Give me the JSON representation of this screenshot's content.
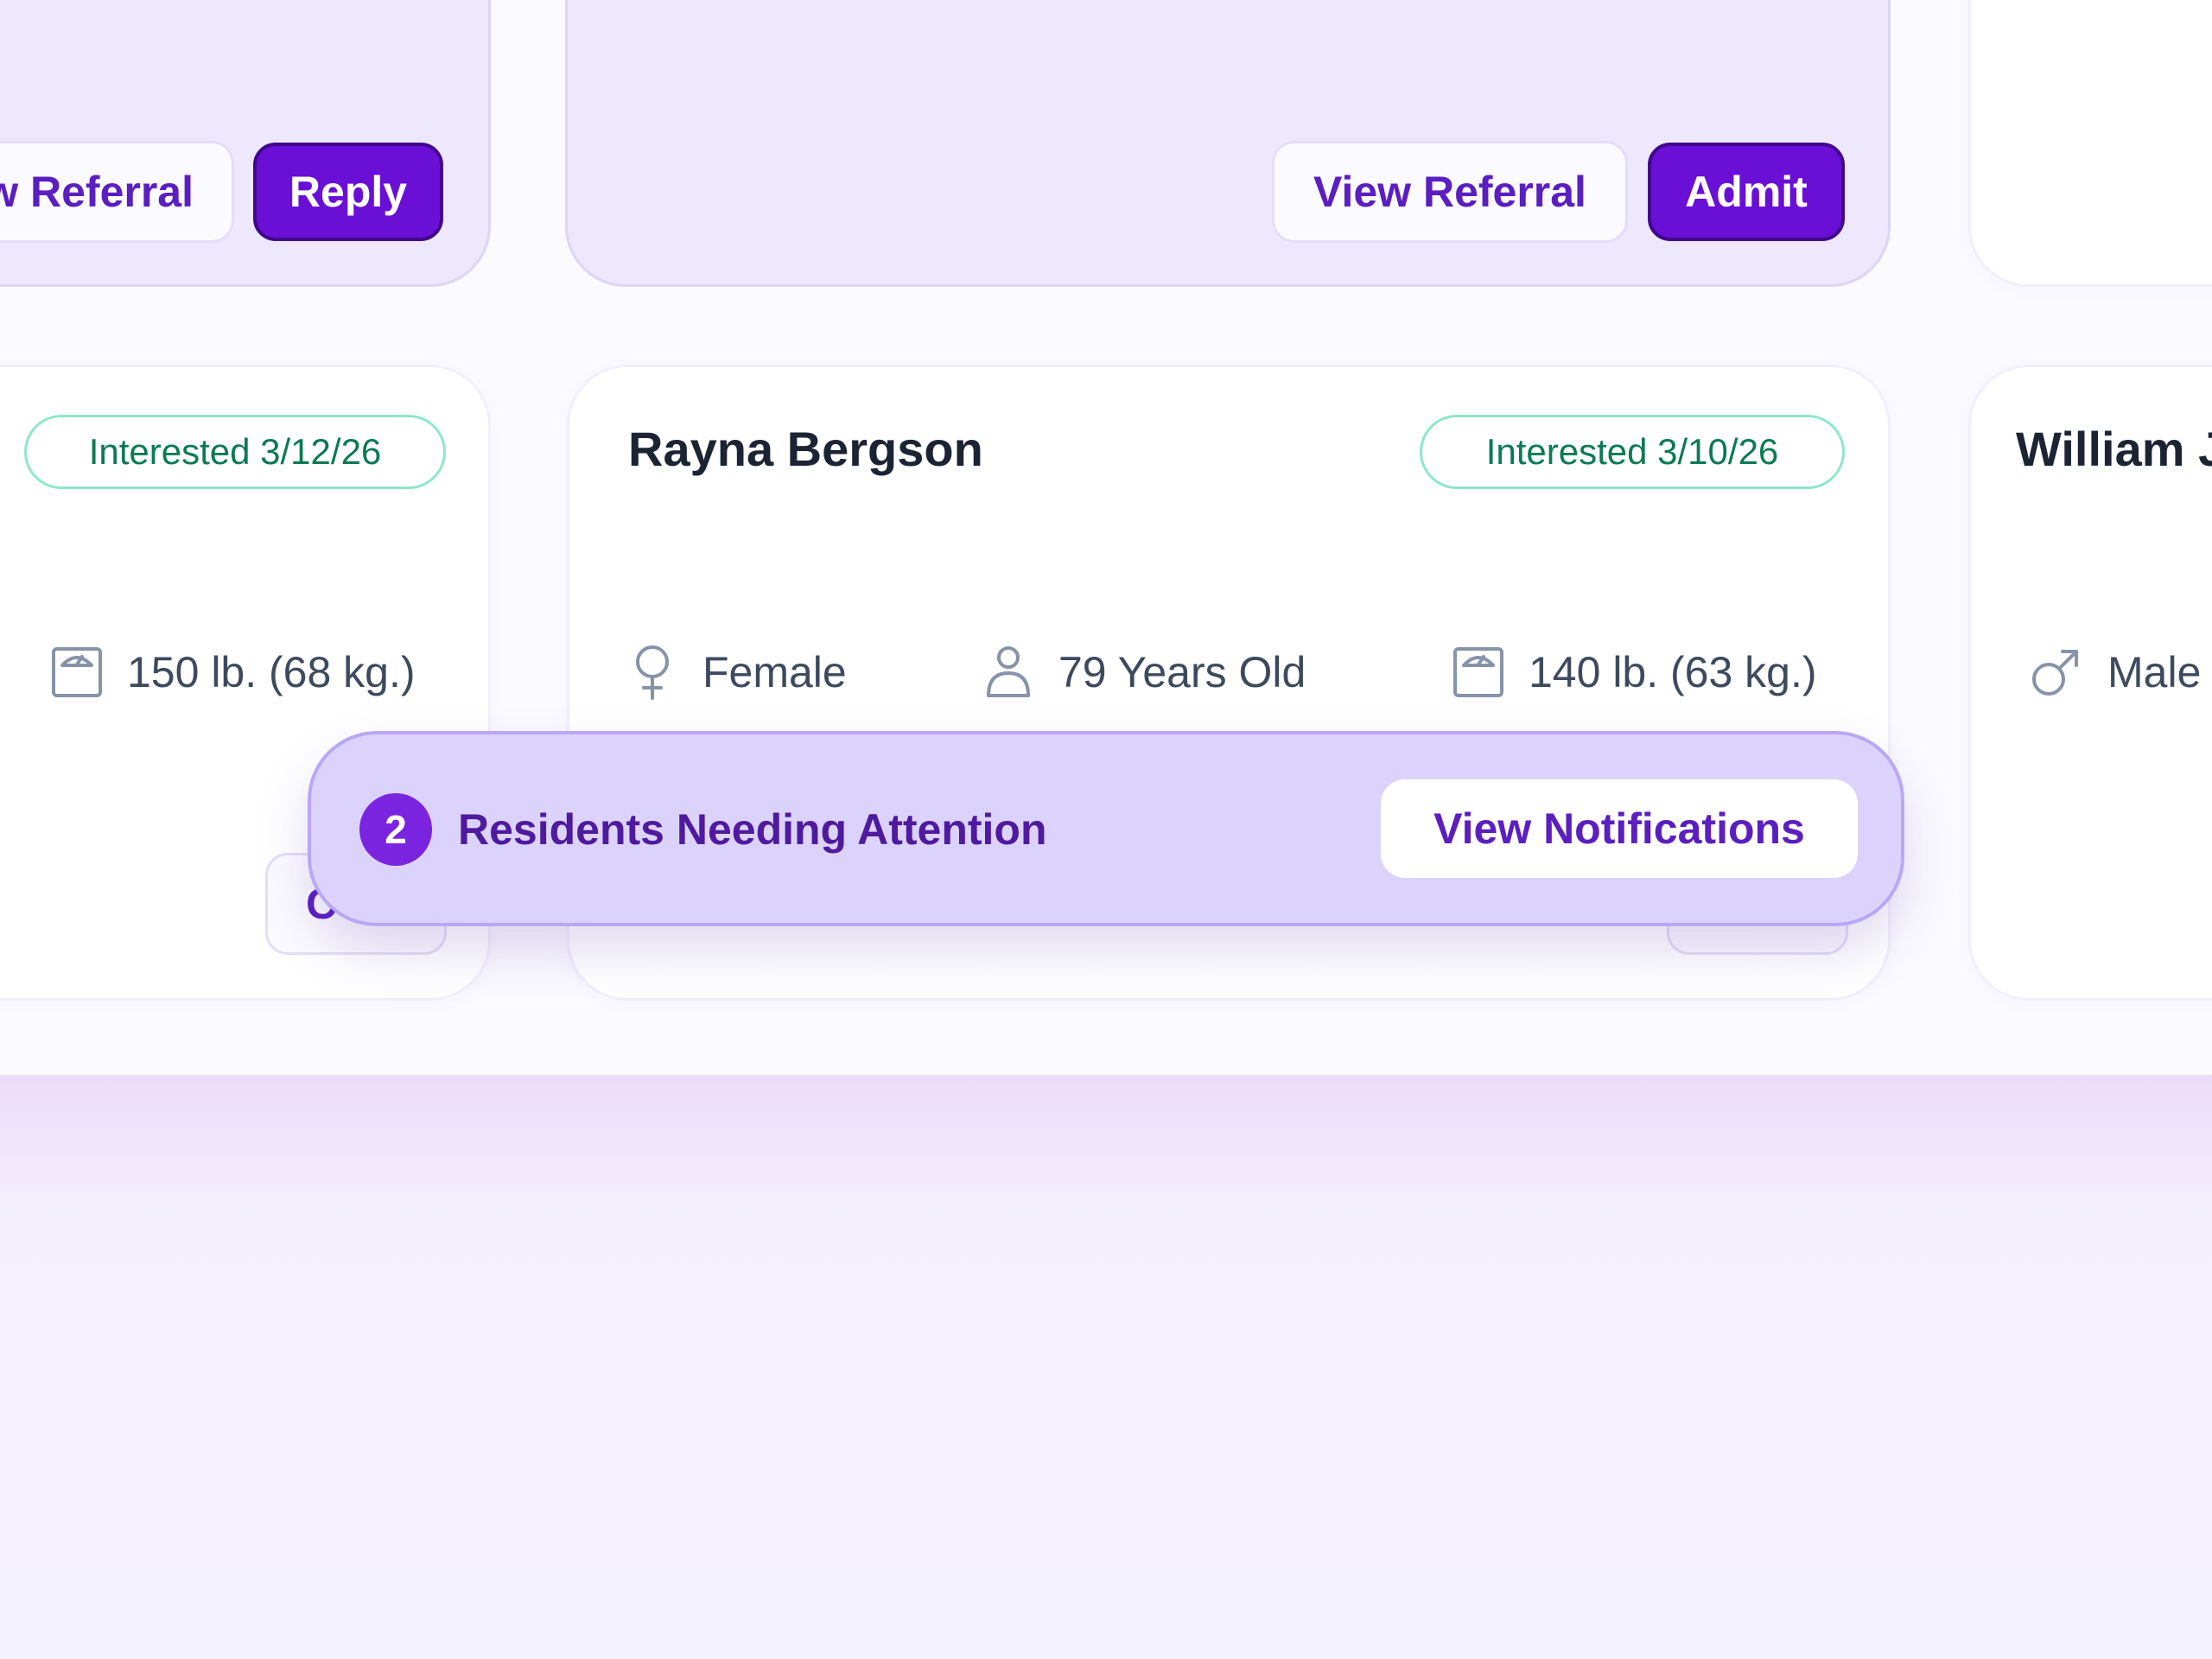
{
  "top_row": {
    "left_card": {
      "view_referral_label": "w Referral",
      "reply_label": "Reply"
    },
    "center_card": {
      "view_referral_label": "View Referral",
      "admit_label": "Admit"
    }
  },
  "resident_cards": {
    "left": {
      "status": "Interested 3/12/26",
      "weight": "150 lb. (68 kg.)",
      "action_fragment": "C"
    },
    "center": {
      "name": "Rayna Bergson",
      "status": "Interested 3/10/26",
      "gender": "Female",
      "age": "79 Years Old",
      "weight": "140 lb. (63 kg.)"
    },
    "right": {
      "name": "William J",
      "gender": "Male"
    }
  },
  "notification": {
    "count": "2",
    "message": "Residents Needing Attention",
    "button_label": "View Notifications"
  },
  "icons": {
    "female": "female-icon",
    "male": "male-icon",
    "person": "person-icon",
    "scale": "scale-icon"
  },
  "colors": {
    "accent": "#6a0fd6",
    "accent_text": "#5b1ec0",
    "status_green": "#0b7a52",
    "status_border": "#8de8c7"
  }
}
